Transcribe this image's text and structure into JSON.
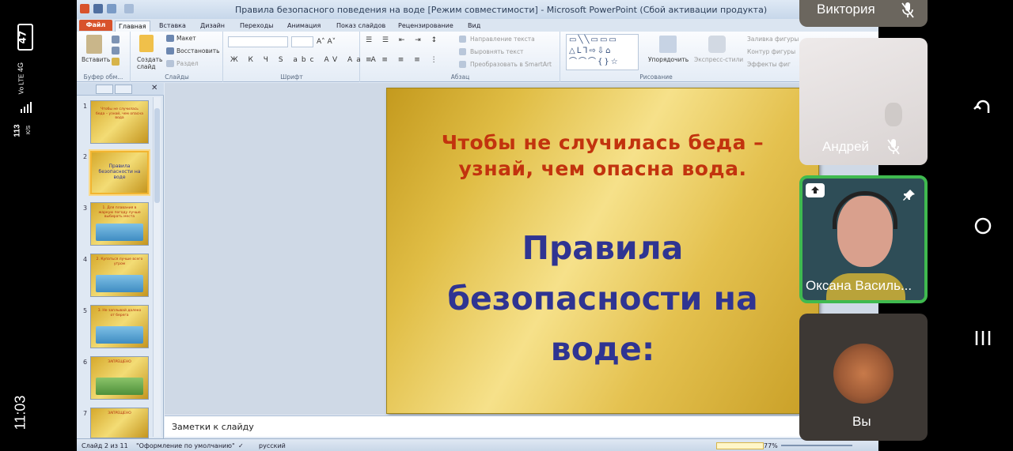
{
  "status_bar": {
    "time": "11:03",
    "battery": "47",
    "network_speed": "113",
    "network_speed_unit": "K/S",
    "network_type": "4G",
    "volte": "Vo LTE"
  },
  "powerpoint": {
    "window_title": "Правила безопасного поведения на воде [Режим совместимости]  -  Microsoft PowerPoint (Сбой активации продукта)",
    "tabs": [
      "Файл",
      "Главная",
      "Вставка",
      "Дизайн",
      "Переходы",
      "Анимация",
      "Показ слайдов",
      "Рецензирование",
      "Вид"
    ],
    "active_tab": "Главная",
    "ribbon": {
      "paste": "Вставить",
      "clipboard_group": "Буфер обм...",
      "new_slide": "Создать слайд",
      "layout": "Макет",
      "reset": "Восстановить",
      "section": "Раздел",
      "slides_group": "Слайды",
      "font_group": "Шрифт",
      "text_direction": "Направление текста",
      "align_text": "Выровнять текст",
      "smartart": "Преобразовать в SmartArt",
      "paragraph_group": "Абзац",
      "arrange": "Упорядочить",
      "quick_styles": "Экспресс-стили",
      "shape_fill": "Заливка фигуры",
      "shape_outline": "Контур фигуры",
      "shape_effects": "Эффекты фиг",
      "drawing_group": "Рисование"
    },
    "thumbnails": [
      {
        "num": "1",
        "text": "Чтобы не случилась беда – узнай, чем опасна вода"
      },
      {
        "num": "2",
        "text": "Правила безопасности на воде"
      },
      {
        "num": "3",
        "text": "1. Для плавания в жаркую погоду лучше выбирать места"
      },
      {
        "num": "4",
        "text": "2. Купаться лучше всего утром"
      },
      {
        "num": "5",
        "text": "3. Не заплывай далеко от берега"
      },
      {
        "num": "6",
        "text": "ЗАПРЕЩЕНО"
      },
      {
        "num": "7",
        "text": "ЗАПРЕЩЕНО"
      }
    ],
    "slide": {
      "subtitle": "Чтобы не случилась беда – узнай, чем опасна вода.",
      "title": "Правила безопасности на воде:"
    },
    "notes_placeholder": "Заметки к слайду",
    "status": {
      "slide_counter": "Слайд 2 из 11",
      "theme": "\"Оформление по умолчанию\"",
      "language": "русский",
      "zoom": "77%"
    }
  },
  "participants": [
    {
      "name": "Виктория",
      "muted": true
    },
    {
      "name": "Андрей",
      "muted": true
    },
    {
      "name": "Оксана Василь...",
      "active_speaker": true,
      "pinned": true
    },
    {
      "name": "Вы"
    }
  ],
  "colors": {
    "slide_subtitle": "#c2330e",
    "slide_title": "#2f3492",
    "active_speaker_border": "#3fba4f",
    "file_tab": "#d8522b"
  }
}
